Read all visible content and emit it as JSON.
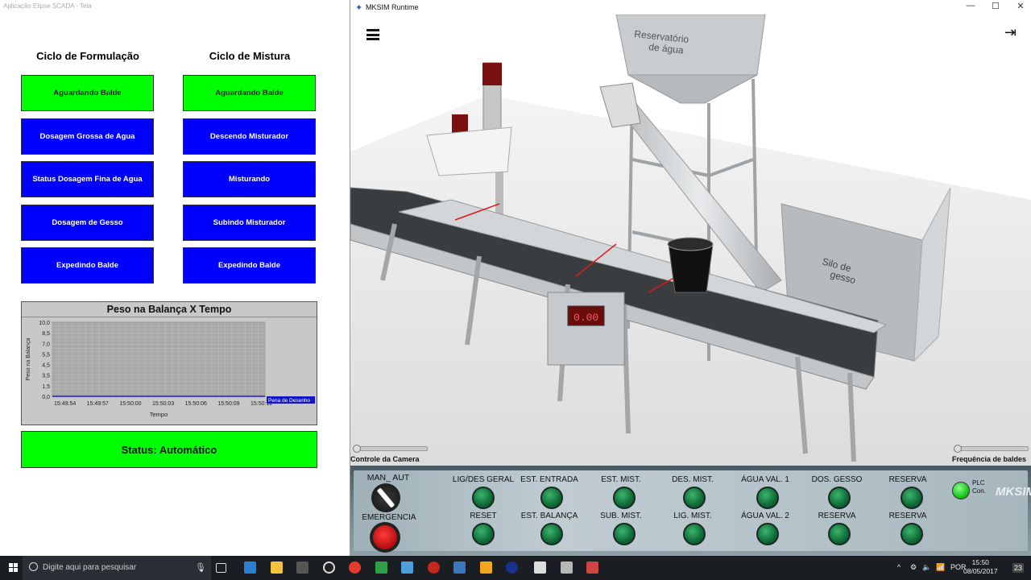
{
  "scada": {
    "window_title": "Aplicação Elipse SCADA - Tela",
    "col1_title": "Ciclo de Formulação",
    "col2_title": "Ciclo de Mistura",
    "col1_buttons": [
      "Aguardando Balde",
      "Dosagem Grossa de Agua",
      "Status Dosagem Fina de Agua",
      "Dosagem de Gesso",
      "Expedindo Balde"
    ],
    "col2_buttons": [
      "Aguardando Balde",
      "Descendo Misturador",
      "Misturando",
      "Subindo Misturador",
      "Expedindo Balde"
    ],
    "status": "Status: Automático",
    "colors": {
      "active": "#00ff00",
      "inactive": "#0000ff"
    }
  },
  "chart_data": {
    "type": "line",
    "title": "Peso na Balança X Tempo",
    "xlabel": "Tempo",
    "ylabel": "Peso na Balança",
    "x_ticks": [
      "15:49:54",
      "15:49:57",
      "15:50:00",
      "15:50:03",
      "15:50:06",
      "15:50:09",
      "15:50:12"
    ],
    "y_ticks": [
      "10,0",
      "8,5",
      "7,0",
      "5,5",
      "4,5",
      "3,5",
      "1,5",
      "0,0"
    ],
    "ylim": [
      0,
      10
    ],
    "grid": true,
    "series": [
      {
        "name": "Pena de Desenho",
        "values": [
          0,
          0,
          0,
          0,
          0,
          0,
          0
        ]
      }
    ],
    "legend": "Pena de Desenho",
    "legend_position": "bottom-right"
  },
  "mksim": {
    "window_title": "MKSIM Runtime",
    "minimize": "—",
    "maximize": "☐",
    "close": "✕",
    "scale_display": "0.00",
    "reservoir_label_1": "Reservatório",
    "reservoir_label_2": "de água",
    "silo_label_1": "Silo de",
    "silo_label_2": "gesso",
    "camera_label": "Controle da Camera",
    "frequency_label": "Frequência de baldes",
    "panel": {
      "selector_label": "MAN_ AUT",
      "emergency_label": "EMERGENCIA",
      "plc_label": "PLC",
      "plc_sub": "Con.",
      "logo": "MKSIM",
      "row1": [
        "LIG/DES GERAL",
        "EST. ENTRADA",
        "EST. MIST.",
        "DES. MIST.",
        "ÁGUA VAL. 1",
        "DOS. GESSO",
        "RESERVA"
      ],
      "row2": [
        "RESET",
        "EST. BALANÇA",
        "SUB. MIST.",
        "LIG. MIST.",
        "ÁGUA VAL. 2",
        "RESERVA",
        "RESERVA"
      ]
    }
  },
  "taskbar": {
    "search_placeholder": "Digite aqui para pesquisar",
    "language": "POR",
    "time": "15:50",
    "date": "08/05/2017",
    "notifications": "23"
  }
}
